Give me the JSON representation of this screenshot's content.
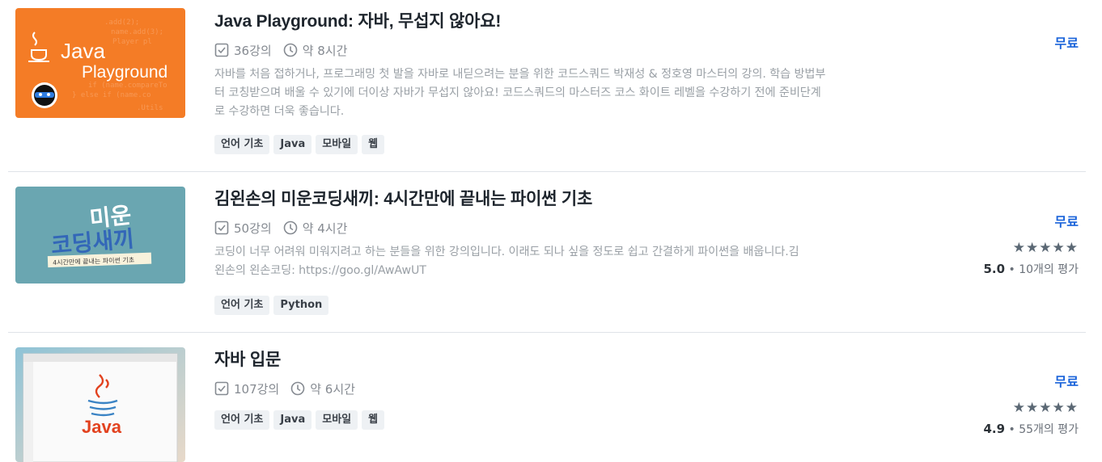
{
  "courses": [
    {
      "title": "Java Playground: 자바, 무섭지 않아요!",
      "lessons": "36강의",
      "duration": "약 8시간",
      "description": "자바를 처음 접하거나, 프로그래밍 첫 발을 자바로 내딛으려는 분을 위한 코드스쿼드 박재성 & 정호영 마스터의 강의. 학습 방법부터 코칭받으며 배울 수 있기에 더이상 자바가 무섭지 않아요! 코드스쿼드의 마스터즈 코스 화이트 레벨을 수강하기 전에 준비단계로 수강하면 더욱 좋습니다.",
      "tags": [
        "언어 기초",
        "Java",
        "모바일",
        "웹"
      ],
      "price": "무료",
      "thumb_text": [
        "Java",
        "Playground"
      ]
    },
    {
      "title": "김왼손의 미운코딩새끼: 4시간만에 끝내는 파이썬 기초",
      "lessons": "50강의",
      "duration": "약 4시간",
      "description": "코딩이 너무 어려워 미워지려고 하는 분들을 위한 강의입니다. 이래도 되나 싶을 정도로 쉽고 간결하게 파이썬을 배웁니다.김왼손의 왼손코딩: https://goo.gl/AwAwUT",
      "tags": [
        "언어 기초",
        "Python"
      ],
      "price": "무료",
      "stars": "★★★★★",
      "rating_value": "5.0",
      "rating_count": "10개의 평가",
      "thumb_text": [
        "미운",
        "코딩새끼",
        "4시간만에 끝내는 파이썬 기초"
      ]
    },
    {
      "title": "자바 입문",
      "lessons": "107강의",
      "duration": "약 6시간",
      "tags": [
        "언어 기초",
        "Java",
        "모바일",
        "웹"
      ],
      "price": "무료",
      "stars": "★★★★★",
      "rating_value": "4.9",
      "rating_count": "55개의 평가",
      "thumb_text": [
        "Java"
      ]
    }
  ],
  "colors": {
    "price": "#1b64da",
    "tag_bg": "#eef1f4",
    "thumb1": "#f47c26",
    "thumb2": "#6aa6b1"
  },
  "icons": {
    "lessons": "checkbox-icon",
    "duration": "clock-icon",
    "rating_separator": "•"
  }
}
